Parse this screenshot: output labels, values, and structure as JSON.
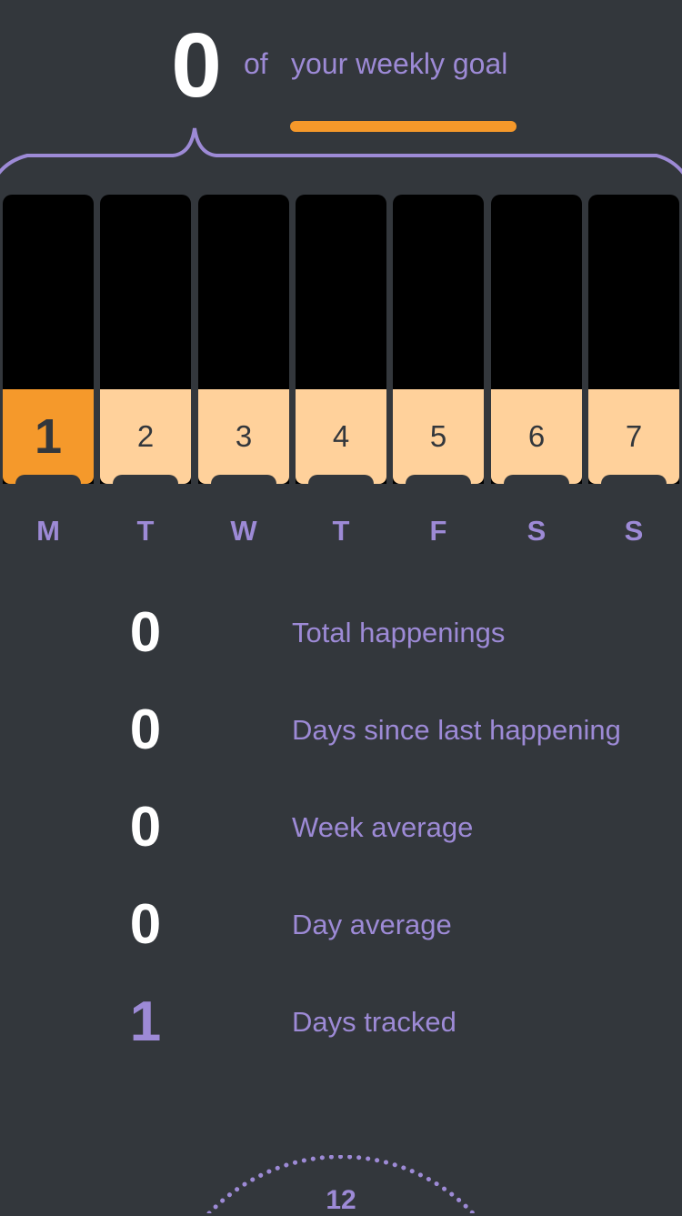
{
  "header": {
    "count": "0",
    "of_label": "of",
    "goal_label": "your weekly goal",
    "progress_fraction": 0
  },
  "days": [
    {
      "number": "1",
      "weekday": "M",
      "active": true
    },
    {
      "number": "2",
      "weekday": "T",
      "active": false
    },
    {
      "number": "3",
      "weekday": "W",
      "active": false
    },
    {
      "number": "4",
      "weekday": "T",
      "active": false
    },
    {
      "number": "5",
      "weekday": "F",
      "active": false
    },
    {
      "number": "6",
      "weekday": "S",
      "active": false
    },
    {
      "number": "7",
      "weekday": "S",
      "active": false
    }
  ],
  "stats": [
    {
      "value": "0",
      "label": "Total happenings"
    },
    {
      "value": "0",
      "label": "Days since last happening"
    },
    {
      "value": "0",
      "label": "Week average"
    },
    {
      "value": "0",
      "label": "Day average"
    },
    {
      "value": "1",
      "label": "Days tracked"
    }
  ],
  "clock": {
    "top_number": "12"
  },
  "colors": {
    "background": "#33373c",
    "accent_purple": "#9d8ad6",
    "accent_orange": "#f5982a",
    "day_light": "#ffd19b",
    "column": "#000000"
  }
}
